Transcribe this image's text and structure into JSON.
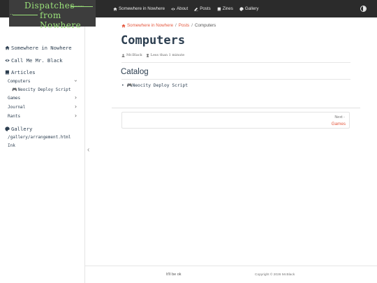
{
  "logo": {
    "line1": "Dispatches",
    "line2": "from Nowhere",
    "dots": ".........",
    "dots2": ".."
  },
  "nav": {
    "items": [
      {
        "label": "Somewhere in Nowhere",
        "icon": "home-icon"
      },
      {
        "label": "About",
        "icon": "eye-icon"
      },
      {
        "label": "Posts",
        "icon": "edit-icon"
      },
      {
        "label": "Zines",
        "icon": "book-icon"
      },
      {
        "label": "Gallery",
        "icon": "palette-icon"
      }
    ],
    "theme_toggle_icon": "contrast-icon"
  },
  "sidebar": {
    "home": "Somewhere in Nowhere",
    "about": "Call Me Mr. Black",
    "articles": "Articles",
    "computers": "Computers",
    "computers_child": "Neocity Deploy Script",
    "games": "Games",
    "journal": "Journal",
    "rants": "Rants",
    "gallery": "Gallery",
    "gallery_item1": "/gallery/arrangement.html",
    "gallery_item2": "Ink",
    "toggle_icon": "chevron-left-icon"
  },
  "breadcrumb": {
    "home": "Somewhere in Nowhere",
    "posts": "Posts",
    "current": "Computers",
    "sep": "/"
  },
  "page": {
    "title": "Computers",
    "author": "Mr.Black",
    "reading_time": "Less than 1 minute",
    "catalog_heading": "Catalog",
    "catalog_items": [
      "Neocity Deploy Script"
    ]
  },
  "pager": {
    "label": "Next -",
    "target": "Games"
  },
  "footer": {
    "left": "It'll be ok",
    "right": "Copyright © 2026 Mr.Black"
  },
  "colors": {
    "navbar": "#2b2b2b",
    "accent": "#e4573d",
    "logo_green": "#9be27a",
    "text": "#2c3e50"
  }
}
